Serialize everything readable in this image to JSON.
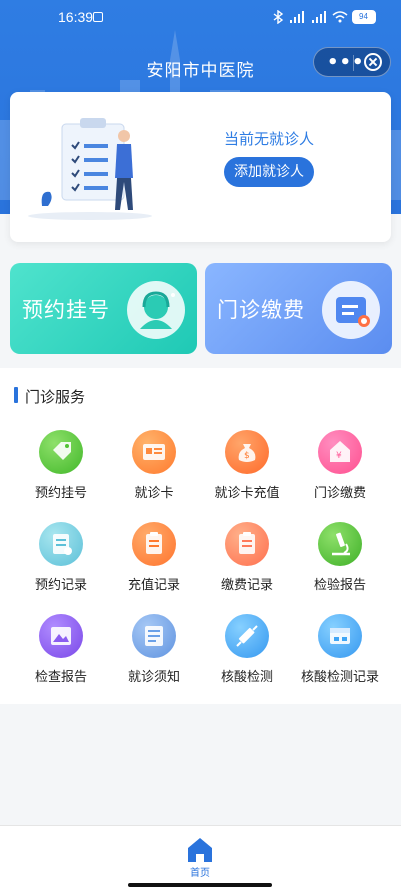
{
  "status_bar": {
    "time": "16:39",
    "battery": "94"
  },
  "header": {
    "title": "安阳市中医院"
  },
  "capsule": {
    "more": "•••"
  },
  "patient_card": {
    "message": "当前无就诊人",
    "add_button": "添加就诊人"
  },
  "quick_actions": [
    {
      "label": "预约挂号",
      "icon": "doctor-icon"
    },
    {
      "label": "门诊缴费",
      "icon": "payment-card-icon"
    }
  ],
  "services": {
    "title": "门诊服务",
    "items": [
      {
        "label": "预约挂号",
        "icon": "tag-icon",
        "color": "#52c234"
      },
      {
        "label": "就诊卡",
        "icon": "id-card-icon",
        "color": "#ff8a3d"
      },
      {
        "label": "就诊卡充值",
        "icon": "money-bag-icon",
        "color": "#ff7a2e"
      },
      {
        "label": "门诊缴费",
        "icon": "hospital-icon",
        "color": "#ff5c9a"
      },
      {
        "label": "预约记录",
        "icon": "record-icon",
        "color": "#6fcfe0"
      },
      {
        "label": "充值记录",
        "icon": "clipboard-icon",
        "color": "#ff7a2e"
      },
      {
        "label": "缴费记录",
        "icon": "clipboard-icon",
        "color": "#ff7a5a"
      },
      {
        "label": "检验报告",
        "icon": "microscope-icon",
        "color": "#4cc23a"
      },
      {
        "label": "检查报告",
        "icon": "image-report-icon",
        "color": "#8b5cf0"
      },
      {
        "label": "就诊须知",
        "icon": "notice-list-icon",
        "color": "#6aa0e8"
      },
      {
        "label": "核酸检测",
        "icon": "syringe-icon",
        "color": "#3fa5f5"
      },
      {
        "label": "核酸检测记录",
        "icon": "cabinet-icon",
        "color": "#3fa5f5"
      }
    ]
  },
  "tabbar": {
    "home_label": "首页"
  },
  "colors": {
    "primary": "#2a73dc",
    "quick1": "#22cbb6",
    "quick2": "#6296f2"
  }
}
